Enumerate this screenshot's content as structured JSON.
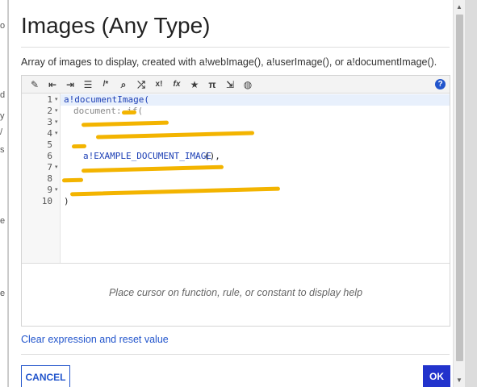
{
  "background": {
    "fragments": [
      "o",
      "d",
      "y",
      "/",
      "s",
      "e",
      "e"
    ]
  },
  "dialog": {
    "title": "Images (Any Type)",
    "description": "Array of images to display, created with a!webImage(), a!userImage(), or a!documentImage()."
  },
  "toolbar": {
    "icons": [
      "magic-wand-icon",
      "outdent-icon",
      "indent-icon",
      "list-icon",
      "comment-icon",
      "search-icon",
      "shuffle-icon",
      "factorial-icon",
      "fx-icon",
      "star-icon",
      "pi-icon",
      "export-icon",
      "globe-icon"
    ],
    "glyphs": [
      "✎",
      "⇤",
      "⇥",
      "☰",
      "/*",
      "⌕",
      "⤮",
      "x!",
      "fx",
      "★",
      "π",
      "⇲",
      "◍"
    ],
    "help_label": "?"
  },
  "code": {
    "line_numbers": [
      "1",
      "2",
      "3",
      "4",
      "5",
      "6",
      "7",
      "8",
      "9",
      "10"
    ],
    "fold_markers": [
      "▾",
      "▾",
      "▾",
      "▾",
      "",
      "",
      "▾",
      "",
      "▾",
      ""
    ],
    "line1": "a!documentImage(",
    "line2": "document: if(",
    "line6_fn": "a!EXAMPLE_DOCUMENT_IMAGE",
    "line6_rest": "(),",
    "line10": ")"
  },
  "help_pane": {
    "placeholder": "Place cursor on function, rule, or constant to display help"
  },
  "footer": {
    "clear_link": "Clear expression and reset value",
    "cancel_label": "CANCEL",
    "ok_label": "OK"
  },
  "colors": {
    "accent": "#2255cc",
    "ok_bg": "#2233cc",
    "redaction": "#f3b400"
  }
}
